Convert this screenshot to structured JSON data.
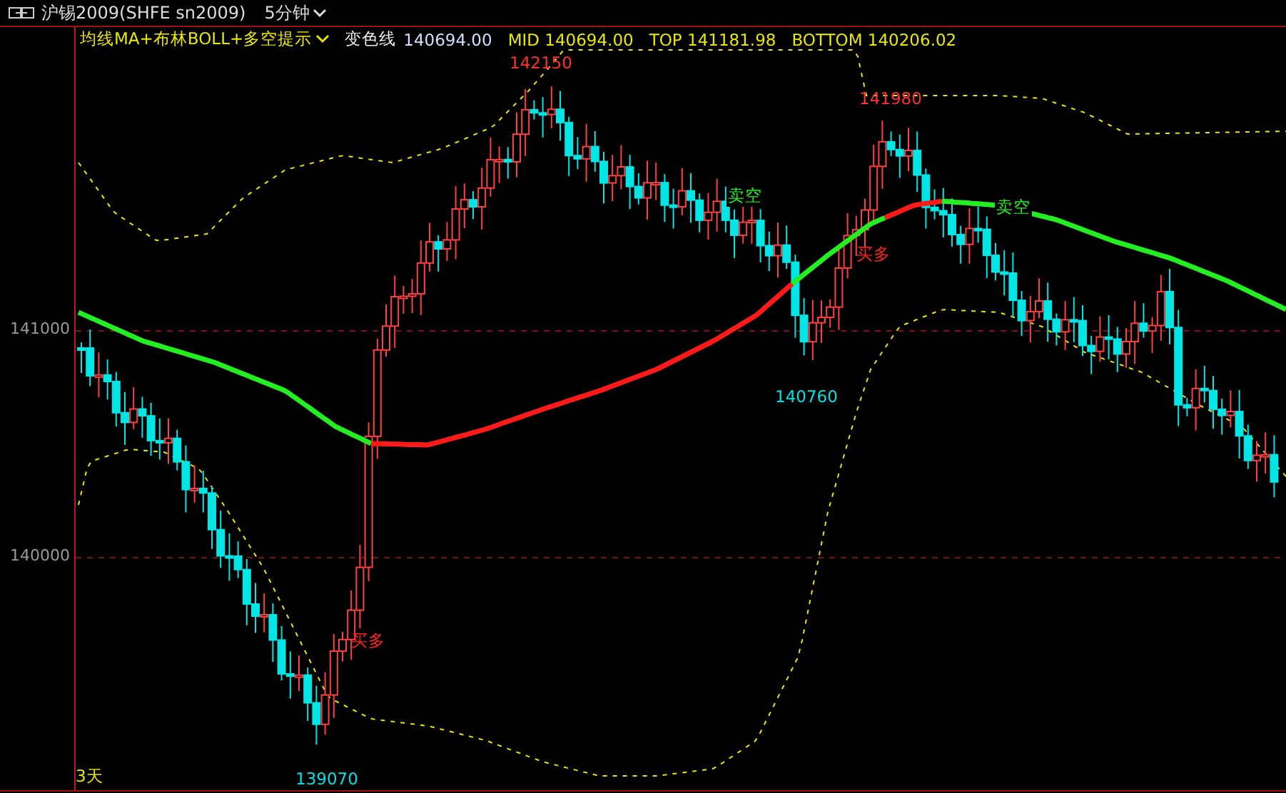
{
  "window": {
    "title": "沪锡2009(SHFE sn2009)",
    "period": "5分钟"
  },
  "indicator": {
    "name": "均线MA+布林BOLL+多空提示",
    "label": "变色线",
    "value": "140694.00",
    "stats": [
      "MID 140694.00",
      "TOP 141181.98",
      "BOTTOM 140206.02"
    ]
  },
  "y_axis": {
    "ticks": [
      "141000",
      "140000"
    ]
  },
  "markers": [
    {
      "kind": "high",
      "text": "142150"
    },
    {
      "kind": "high",
      "text": "141980"
    },
    {
      "kind": "sell",
      "text": "卖空"
    },
    {
      "kind": "sell",
      "text": "卖空"
    },
    {
      "kind": "buy",
      "text": "买多"
    },
    {
      "kind": "low",
      "text": "140760"
    },
    {
      "kind": "buy",
      "text": "买多"
    },
    {
      "kind": "low",
      "text": "139070"
    }
  ],
  "range_label": "3天"
}
